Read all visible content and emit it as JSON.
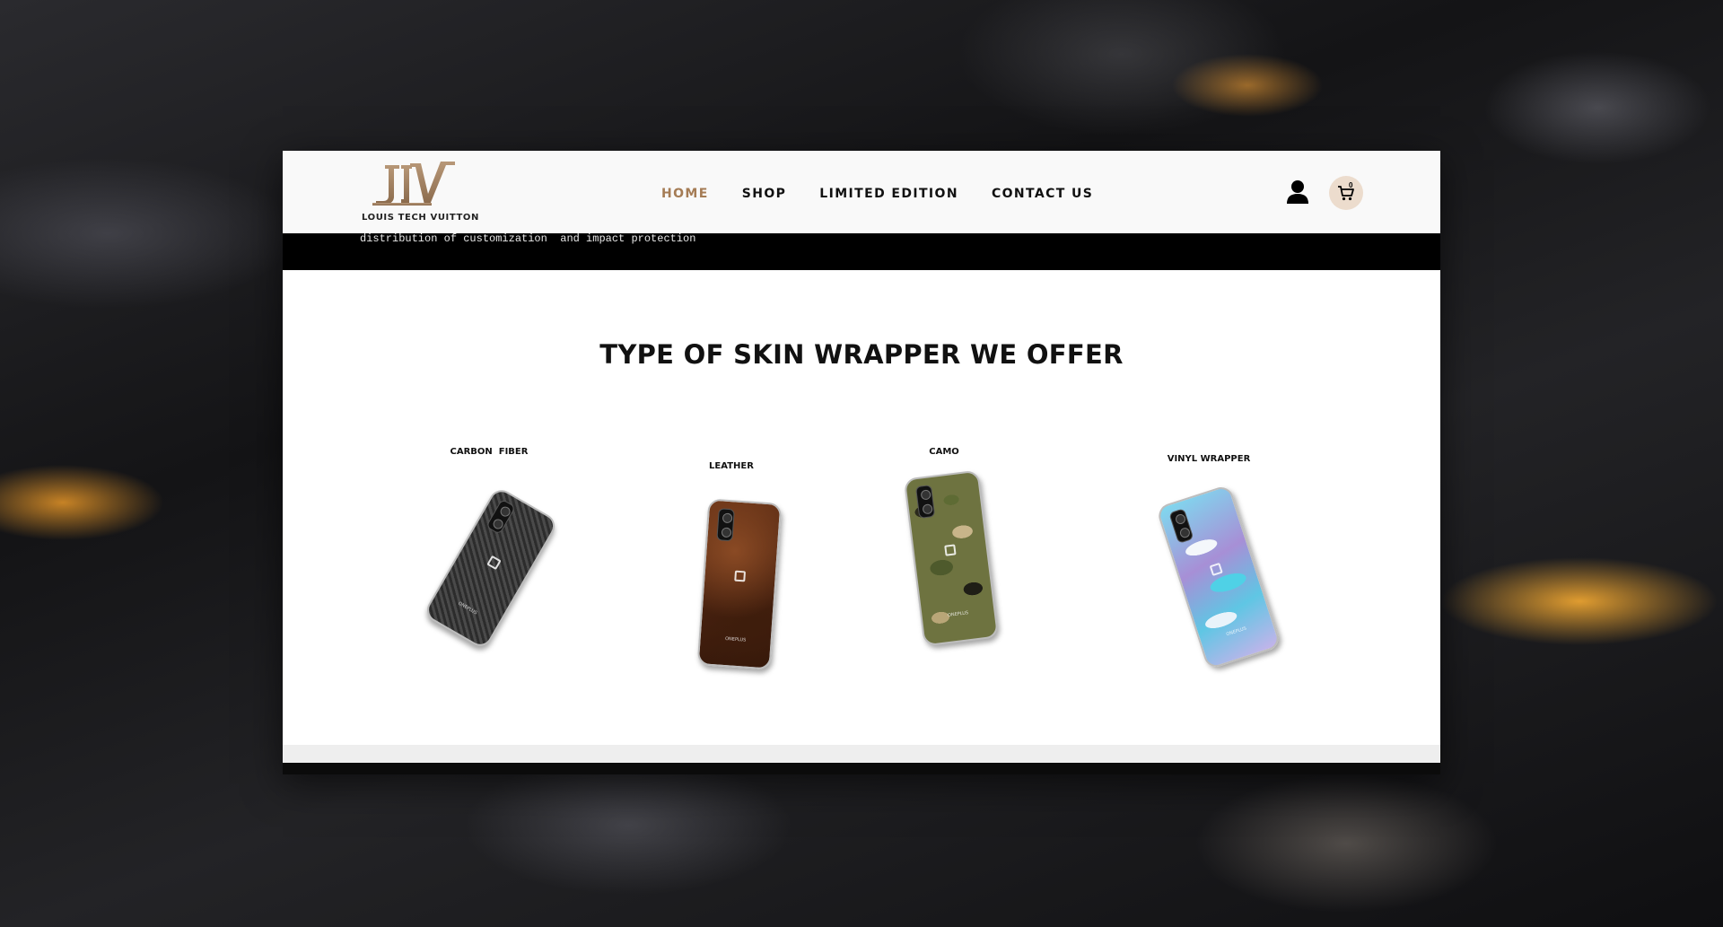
{
  "brand": {
    "logo_text": "LOUIS TECH VUITTON",
    "accent_color": "#a57c55"
  },
  "nav": {
    "items": [
      "HOME",
      "SHOP",
      "LIMITED EDITION",
      "CONTACT US"
    ],
    "active": "HOME"
  },
  "header_icons": {
    "user": "user-icon",
    "cart": "cart-icon",
    "cart_count": "0"
  },
  "banner": {
    "text": "distribution of customization  and impact protection"
  },
  "section": {
    "title": "TYPE OF SKIN WRAPPER WE OFFER"
  },
  "products": [
    {
      "label": "CARBON  FIBER",
      "phone_brand": "ONEPLUS"
    },
    {
      "label": "LEATHER",
      "phone_brand": "ONEPLUS"
    },
    {
      "label": "CAMO",
      "phone_brand": "ONEPLUS"
    },
    {
      "label": "VINYL WRAPPER",
      "phone_brand": "ONEPLUS"
    }
  ]
}
